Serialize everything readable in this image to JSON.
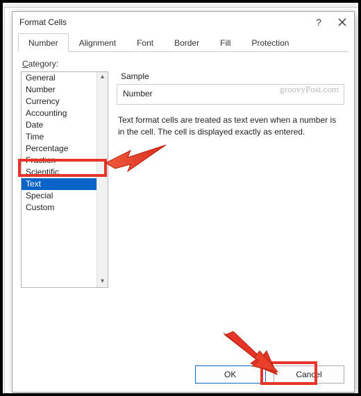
{
  "window": {
    "title": "Format Cells",
    "help_label": "?",
    "close_label": "×"
  },
  "tabs": {
    "number": "Number",
    "alignment": "Alignment",
    "font": "Font",
    "border": "Border",
    "fill": "Fill",
    "protection": "Protection"
  },
  "category": {
    "label_pre": "C",
    "label_rest": "ategory:",
    "items": [
      "General",
      "Number",
      "Currency",
      "Accounting",
      "Date",
      "Time",
      "Percentage",
      "Fraction",
      "Scientific",
      "Text",
      "Special",
      "Custom"
    ],
    "selected_index": 9
  },
  "sample": {
    "label": "Sample",
    "value": "Number"
  },
  "description": "Text format cells are treated as text even when a number is in the cell. The cell is displayed exactly as entered.",
  "buttons": {
    "ok": "OK",
    "cancel": "Cancel"
  },
  "watermark": "groovyPost.com",
  "ribbon": {
    "right_hint": ""
  }
}
